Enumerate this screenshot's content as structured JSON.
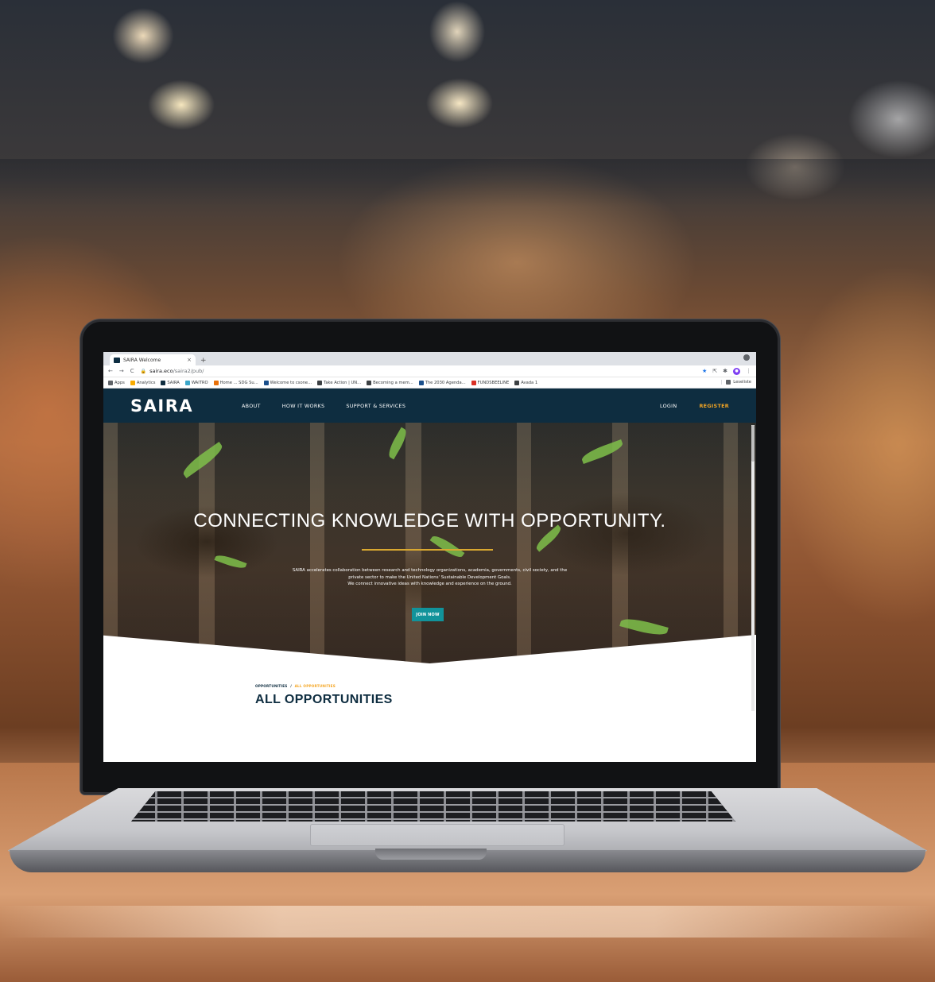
{
  "browser": {
    "tab_title": "SAIRA Welcome",
    "tab_close": "×",
    "new_tab": "+",
    "back": "←",
    "forward": "→",
    "reload": "C",
    "url_host": "saira.eco",
    "url_path": "/saira2/pub/",
    "bookmarks": [
      {
        "label": "Apps",
        "color": "#5f6368"
      },
      {
        "label": "Analytics",
        "color": "#f9ab00"
      },
      {
        "label": "SAIRA",
        "color": "#0e2d40"
      },
      {
        "label": "WAITRO",
        "color": "#3aa6c9"
      },
      {
        "label": "Home ... SDG Su...",
        "color": "#e8710a"
      },
      {
        "label": "Welcome to csone...",
        "color": "#1a4f8b"
      },
      {
        "label": "Take Action | UN...",
        "color": "#3c4043"
      },
      {
        "label": "Becoming a mem...",
        "color": "#3c4043"
      },
      {
        "label": "The 2030 Agenda...",
        "color": "#1a4f8b"
      },
      {
        "label": "FUNDSBEELINE",
        "color": "#d93025"
      },
      {
        "label": "Avada 1",
        "color": "#3c4043"
      }
    ],
    "reading_list": "Leseliste"
  },
  "site": {
    "logo": "SAIRA",
    "nav": {
      "about": "ABOUT",
      "how_it_works": "HOW IT WORKS",
      "support": "SUPPORT & SERVICES",
      "login": "LOGIN",
      "register": "REGISTER"
    },
    "hero": {
      "title": "CONNECTING KNOWLEDGE WITH OPPORTUNITY.",
      "line1": "SAIRA accelerates collaboration between research and technology organizations, academia, governments, civil society, and the",
      "line2": "private sector to make the United Nations' Sustainable Development Goals.",
      "line3": "We connect innovative ideas with knowledge and experience on the ground.",
      "cta": "JOIN NOW"
    },
    "breadcrumb": {
      "root": "OPPORTUNITIES",
      "separator": "/",
      "current": "ALL OPPORTUNITIES"
    },
    "page_title": "ALL OPPORTUNITIES"
  },
  "colors": {
    "navy": "#0e2d40",
    "accent": "#f5a623",
    "button": "#11939b"
  }
}
